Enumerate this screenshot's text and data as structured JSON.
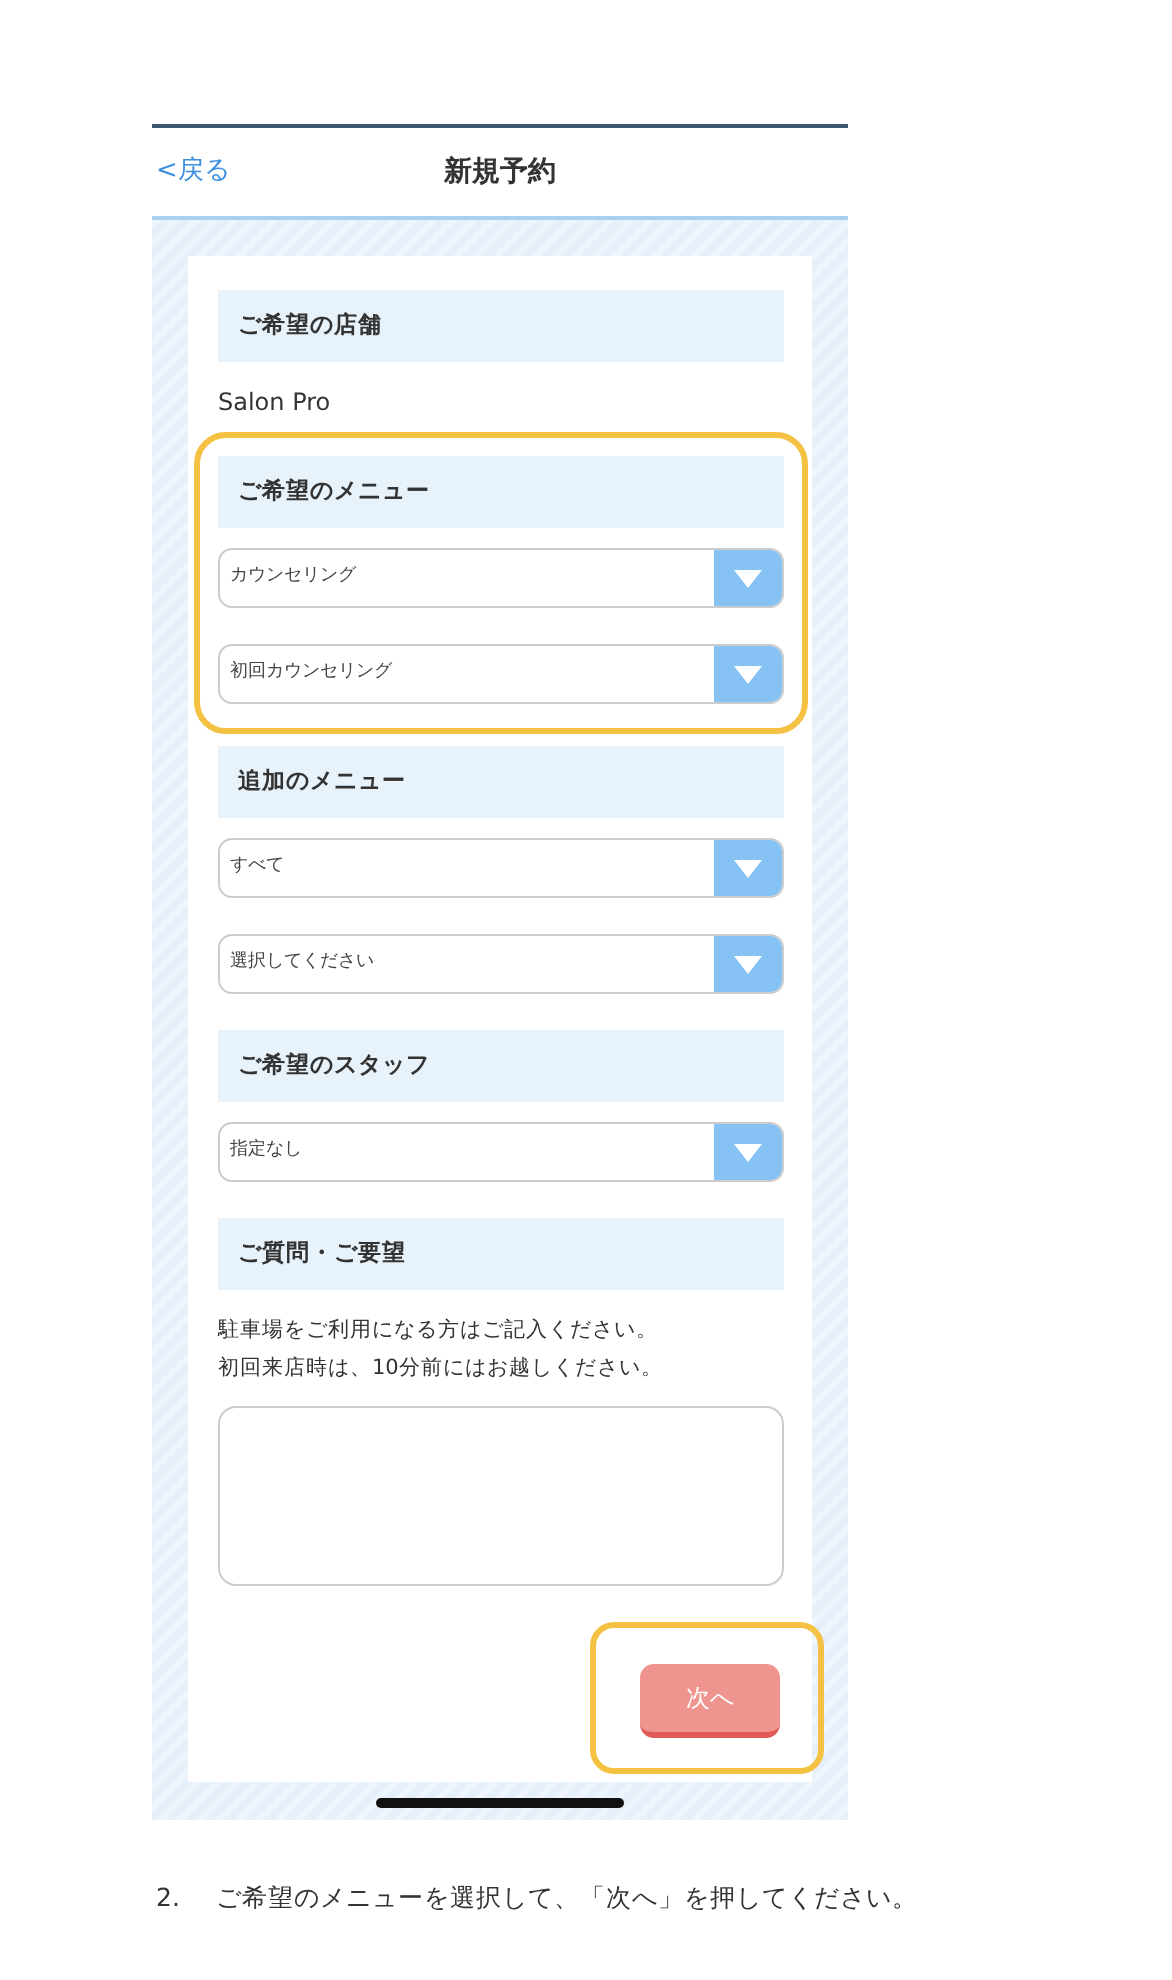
{
  "header": {
    "back": "<戻る",
    "title": "新規予約"
  },
  "sections": [
    {
      "heading": "ご希望の店舗",
      "highlighted": false,
      "kind": "text",
      "text": "Salon Pro"
    },
    {
      "heading": "ご希望のメニュー",
      "highlighted": true,
      "kind": "selects",
      "selects": [
        "カウンセリング",
        "初回カウンセリング"
      ]
    },
    {
      "heading": "追加のメニュー",
      "highlighted": false,
      "kind": "selects",
      "selects": [
        "すべて",
        "選択してください"
      ]
    },
    {
      "heading": "ご希望のスタッフ",
      "highlighted": false,
      "kind": "selects",
      "selects": [
        "指定なし"
      ]
    },
    {
      "heading": "ご質問・ご要望",
      "highlighted": false,
      "kind": "textarea",
      "notes": [
        "駐車場をご利用になる方はご記入ください。",
        "初回来店時は、10分前にはお越しください。"
      ]
    }
  ],
  "next_button": {
    "label": "次へ",
    "highlighted": true
  },
  "instruction": {
    "number": "2.",
    "text": "ご希望のメニューを選択して、「次へ」を押してください。"
  }
}
